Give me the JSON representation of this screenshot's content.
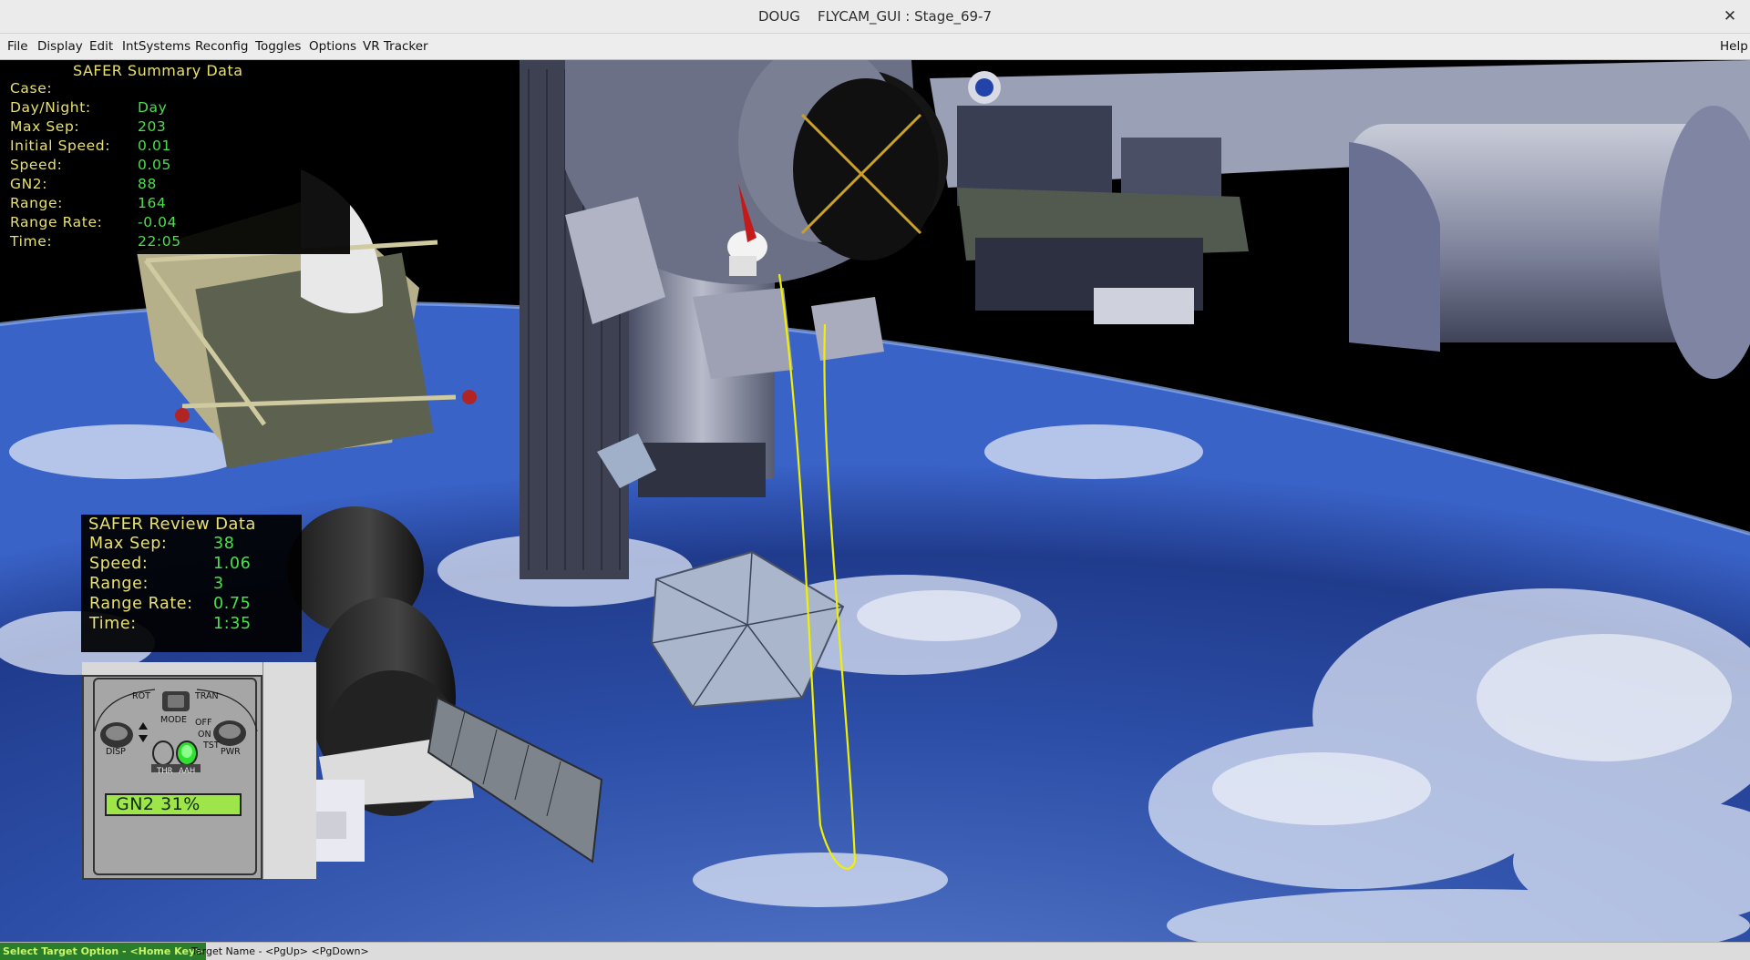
{
  "window": {
    "title": "DOUG    FLYCAM_GUI : Stage_69-7",
    "close_glyph": "✕"
  },
  "menubar": {
    "left": [
      "File",
      "Display",
      "Edit",
      "IntSystems",
      "Reconfig",
      "Toggles",
      "Options",
      "VR Tracker"
    ],
    "help": "Help"
  },
  "summary": {
    "title": "SAFER Summary Data",
    "rows": [
      {
        "label": "Case:",
        "value": ""
      },
      {
        "label": "Day/Night:",
        "value": "Day"
      },
      {
        "label": "Max Sep:",
        "value": "203"
      },
      {
        "label": "Initial Speed:",
        "value": "0.01"
      },
      {
        "label": "Speed:",
        "value": "0.05"
      },
      {
        "label": "GN2:",
        "value": "88"
      },
      {
        "label": "Range:",
        "value": "164"
      },
      {
        "label": "Range Rate:",
        "value": "-0.04"
      },
      {
        "label": "Time:",
        "value": "22:05"
      }
    ]
  },
  "review": {
    "title": "SAFER Review Data",
    "rows": [
      {
        "label": "Max Sep:",
        "value": "38"
      },
      {
        "label": "Speed:",
        "value": "1.06"
      },
      {
        "label": "Range:",
        "value": "3"
      },
      {
        "label": "Range Rate:",
        "value": "0.75"
      },
      {
        "label": "Time:",
        "value": "1:35"
      }
    ]
  },
  "hcm": {
    "rot": "ROT",
    "tran": "TRAN",
    "mode": "MODE",
    "off": "OFF",
    "on": "ON",
    "tst": "TST",
    "disp": "DISP",
    "pwr": "PWR",
    "thr": "THR",
    "aah": "AAH",
    "gn2_label": "GN2 31%",
    "gn2_percent": 31
  },
  "statusbar": {
    "select_option": "Select Target Option - <Home Key>",
    "target_name": "Target Name - <PgUp> <PgDown>"
  },
  "colors": {
    "panel_label": "#e8e070",
    "panel_value": "#4be04b",
    "status_accent": "#2a7d2a",
    "tether": "#f0f000"
  }
}
